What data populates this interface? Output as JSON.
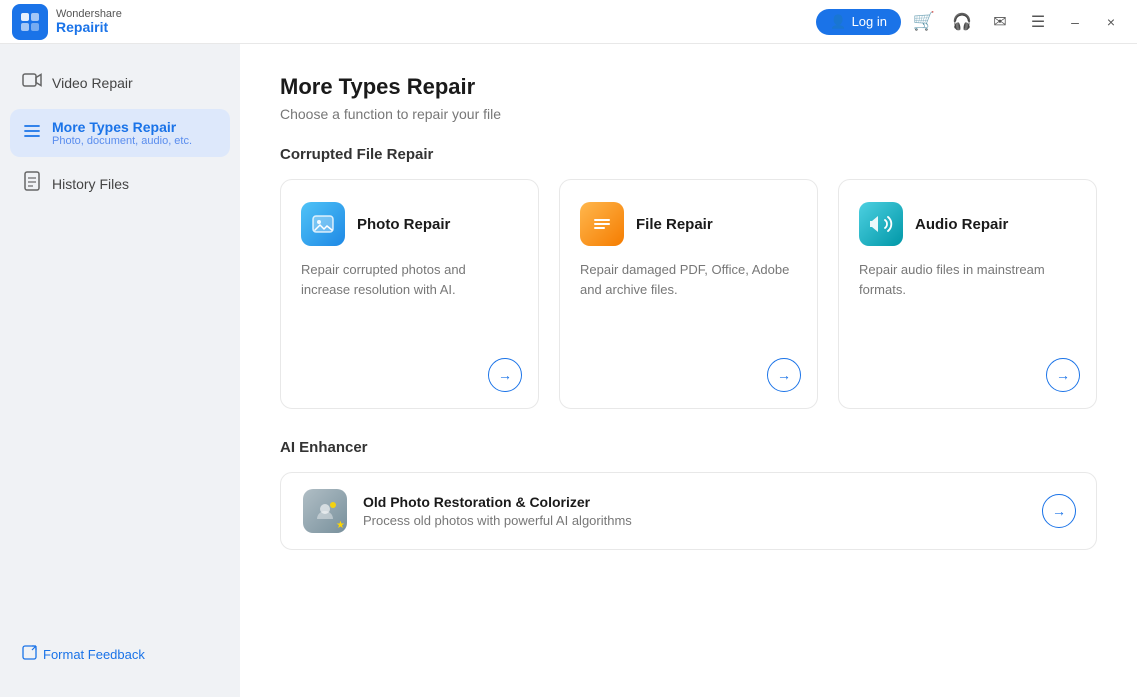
{
  "titlebar": {
    "brand": "Wondershare",
    "appname": "Repairit",
    "login_label": "Log in",
    "min_label": "–",
    "close_label": "×"
  },
  "sidebar": {
    "items": [
      {
        "id": "video-repair",
        "label": "Video Repair",
        "sublabel": "",
        "active": false
      },
      {
        "id": "more-types-repair",
        "label": "More Types Repair",
        "sublabel": "Photo, document, audio, etc.",
        "active": true
      },
      {
        "id": "history-files",
        "label": "History Files",
        "sublabel": "",
        "active": false
      }
    ],
    "feedback_label": "Format Feedback"
  },
  "content": {
    "page_title": "More Types Repair",
    "page_subtitle": "Choose a function to repair your file",
    "corrupted_section_title": "Corrupted File Repair",
    "ai_section_title": "AI Enhancer",
    "cards": [
      {
        "id": "photo-repair",
        "title": "Photo Repair",
        "desc": "Repair corrupted photos and increase resolution with AI.",
        "icon_type": "photo"
      },
      {
        "id": "file-repair",
        "title": "File Repair",
        "desc": "Repair damaged PDF, Office, Adobe and archive files.",
        "icon_type": "file"
      },
      {
        "id": "audio-repair",
        "title": "Audio Repair",
        "desc": "Repair audio files in mainstream formats.",
        "icon_type": "audio"
      }
    ],
    "ai_card": {
      "id": "old-photo-restoration",
      "title": "Old Photo Restoration & Colorizer",
      "desc": "Process old photos with powerful AI algorithms"
    }
  }
}
